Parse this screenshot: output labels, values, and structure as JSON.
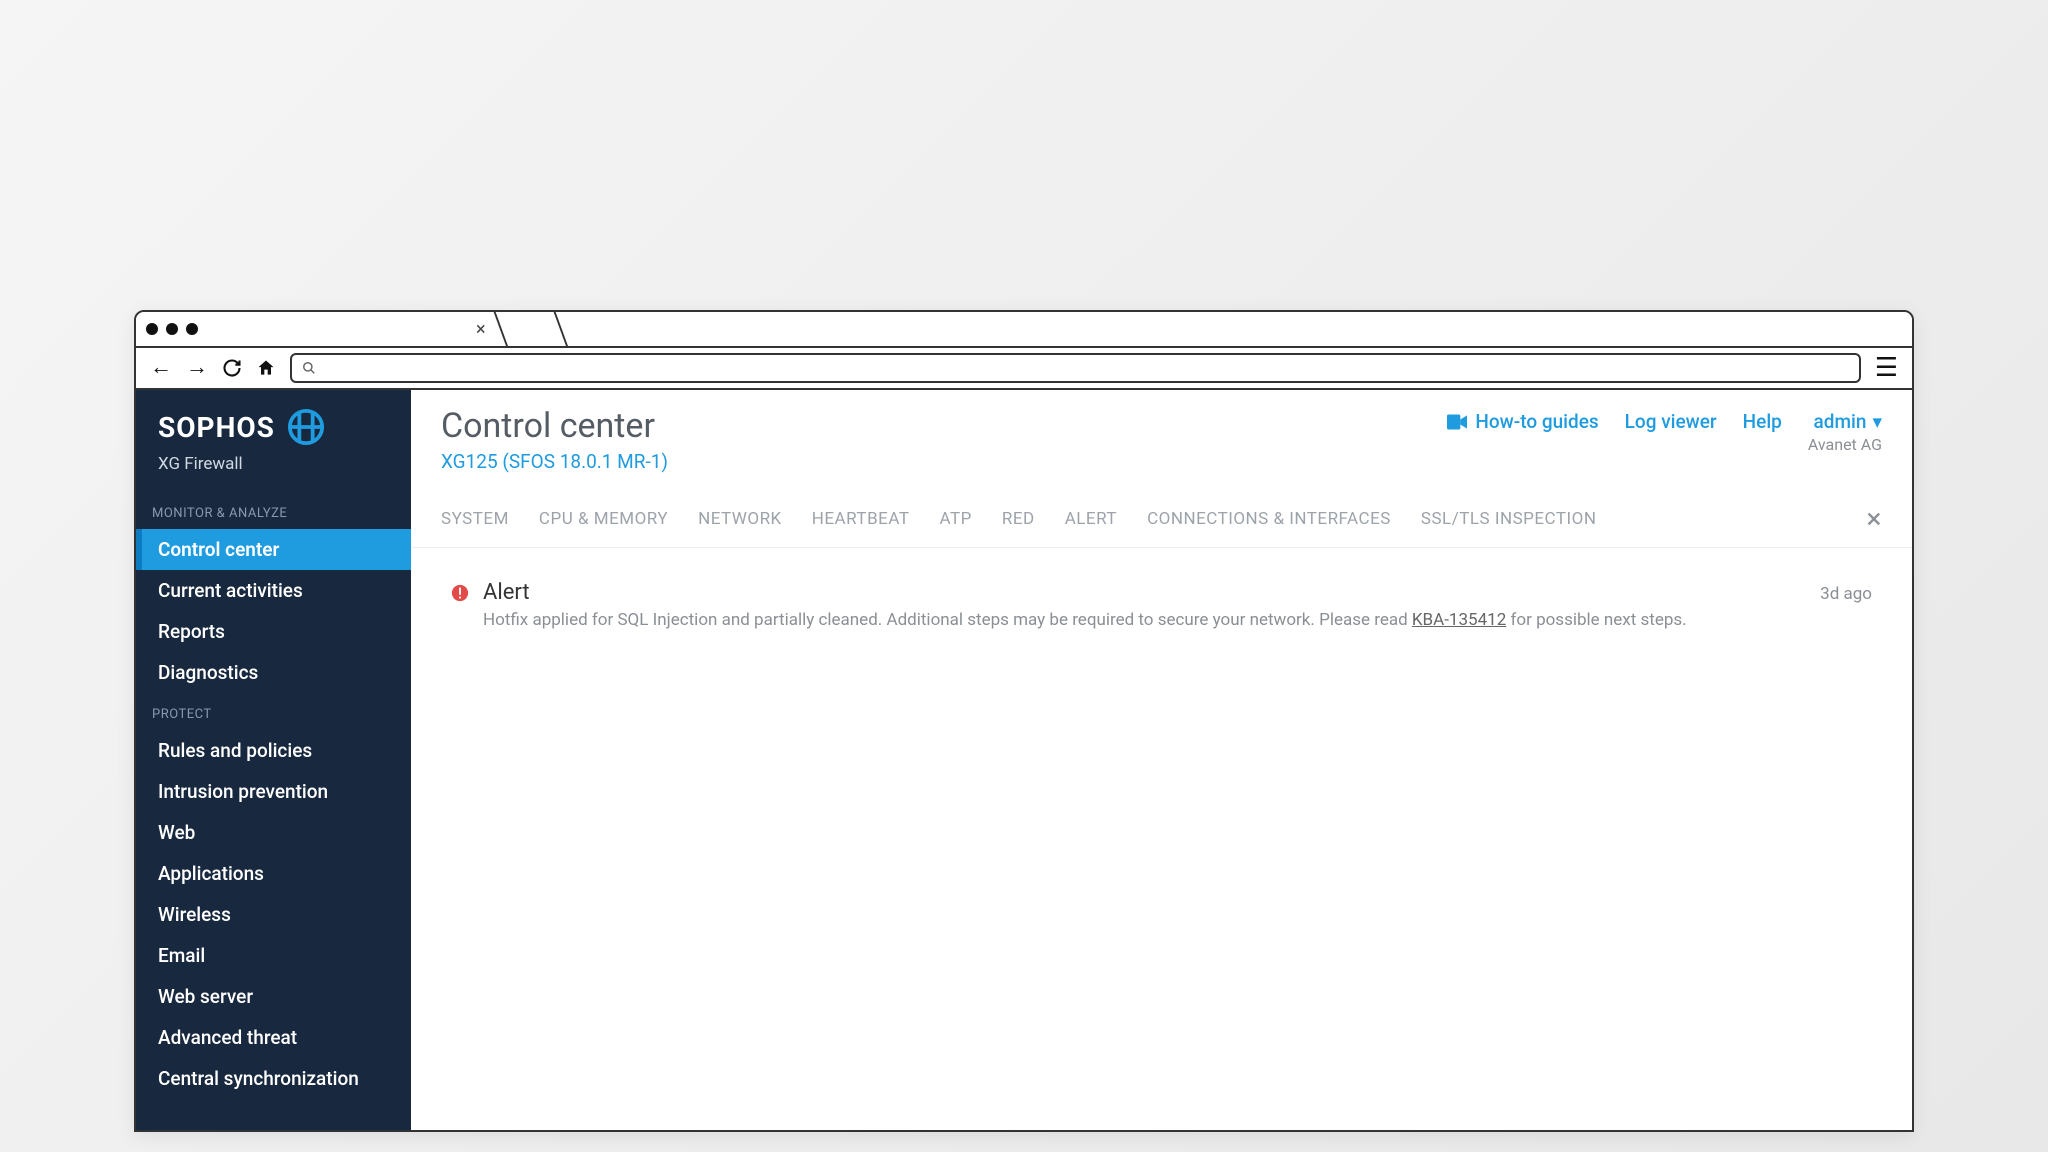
{
  "brand": {
    "name": "SOPHOS",
    "product": "XG Firewall"
  },
  "page": {
    "title": "Control center",
    "subtitle": "XG125 (SFOS 18.0.1 MR-1)"
  },
  "header_links": {
    "guides": "How-to guides",
    "log_viewer": "Log viewer",
    "help": "Help"
  },
  "user": {
    "name": "admin",
    "org": "Avanet AG"
  },
  "sidebar": {
    "sections": [
      {
        "label": "MONITOR & ANALYZE",
        "items": [
          {
            "label": "Control center",
            "active": true
          },
          {
            "label": "Current activities"
          },
          {
            "label": "Reports"
          },
          {
            "label": "Diagnostics"
          }
        ]
      },
      {
        "label": "PROTECT",
        "items": [
          {
            "label": "Rules and policies"
          },
          {
            "label": "Intrusion prevention"
          },
          {
            "label": "Web"
          },
          {
            "label": "Applications"
          },
          {
            "label": "Wireless"
          },
          {
            "label": "Email"
          },
          {
            "label": "Web server"
          },
          {
            "label": "Advanced threat"
          },
          {
            "label": "Central synchronization"
          }
        ]
      }
    ]
  },
  "tabs": {
    "items": [
      "SYSTEM",
      "CPU & MEMORY",
      "NETWORK",
      "HEARTBEAT",
      "ATP",
      "RED",
      "ALERT",
      "CONNECTIONS & INTERFACES",
      "SSL/TLS INSPECTION"
    ]
  },
  "alert": {
    "title": "Alert",
    "desc_pre": "Hotfix applied for SQL Injection and partially cleaned. Additional steps may be required to secure your network. Please read ",
    "kba": "KBA-135412",
    "desc_post": " for possible next steps.",
    "time": "3d ago"
  }
}
